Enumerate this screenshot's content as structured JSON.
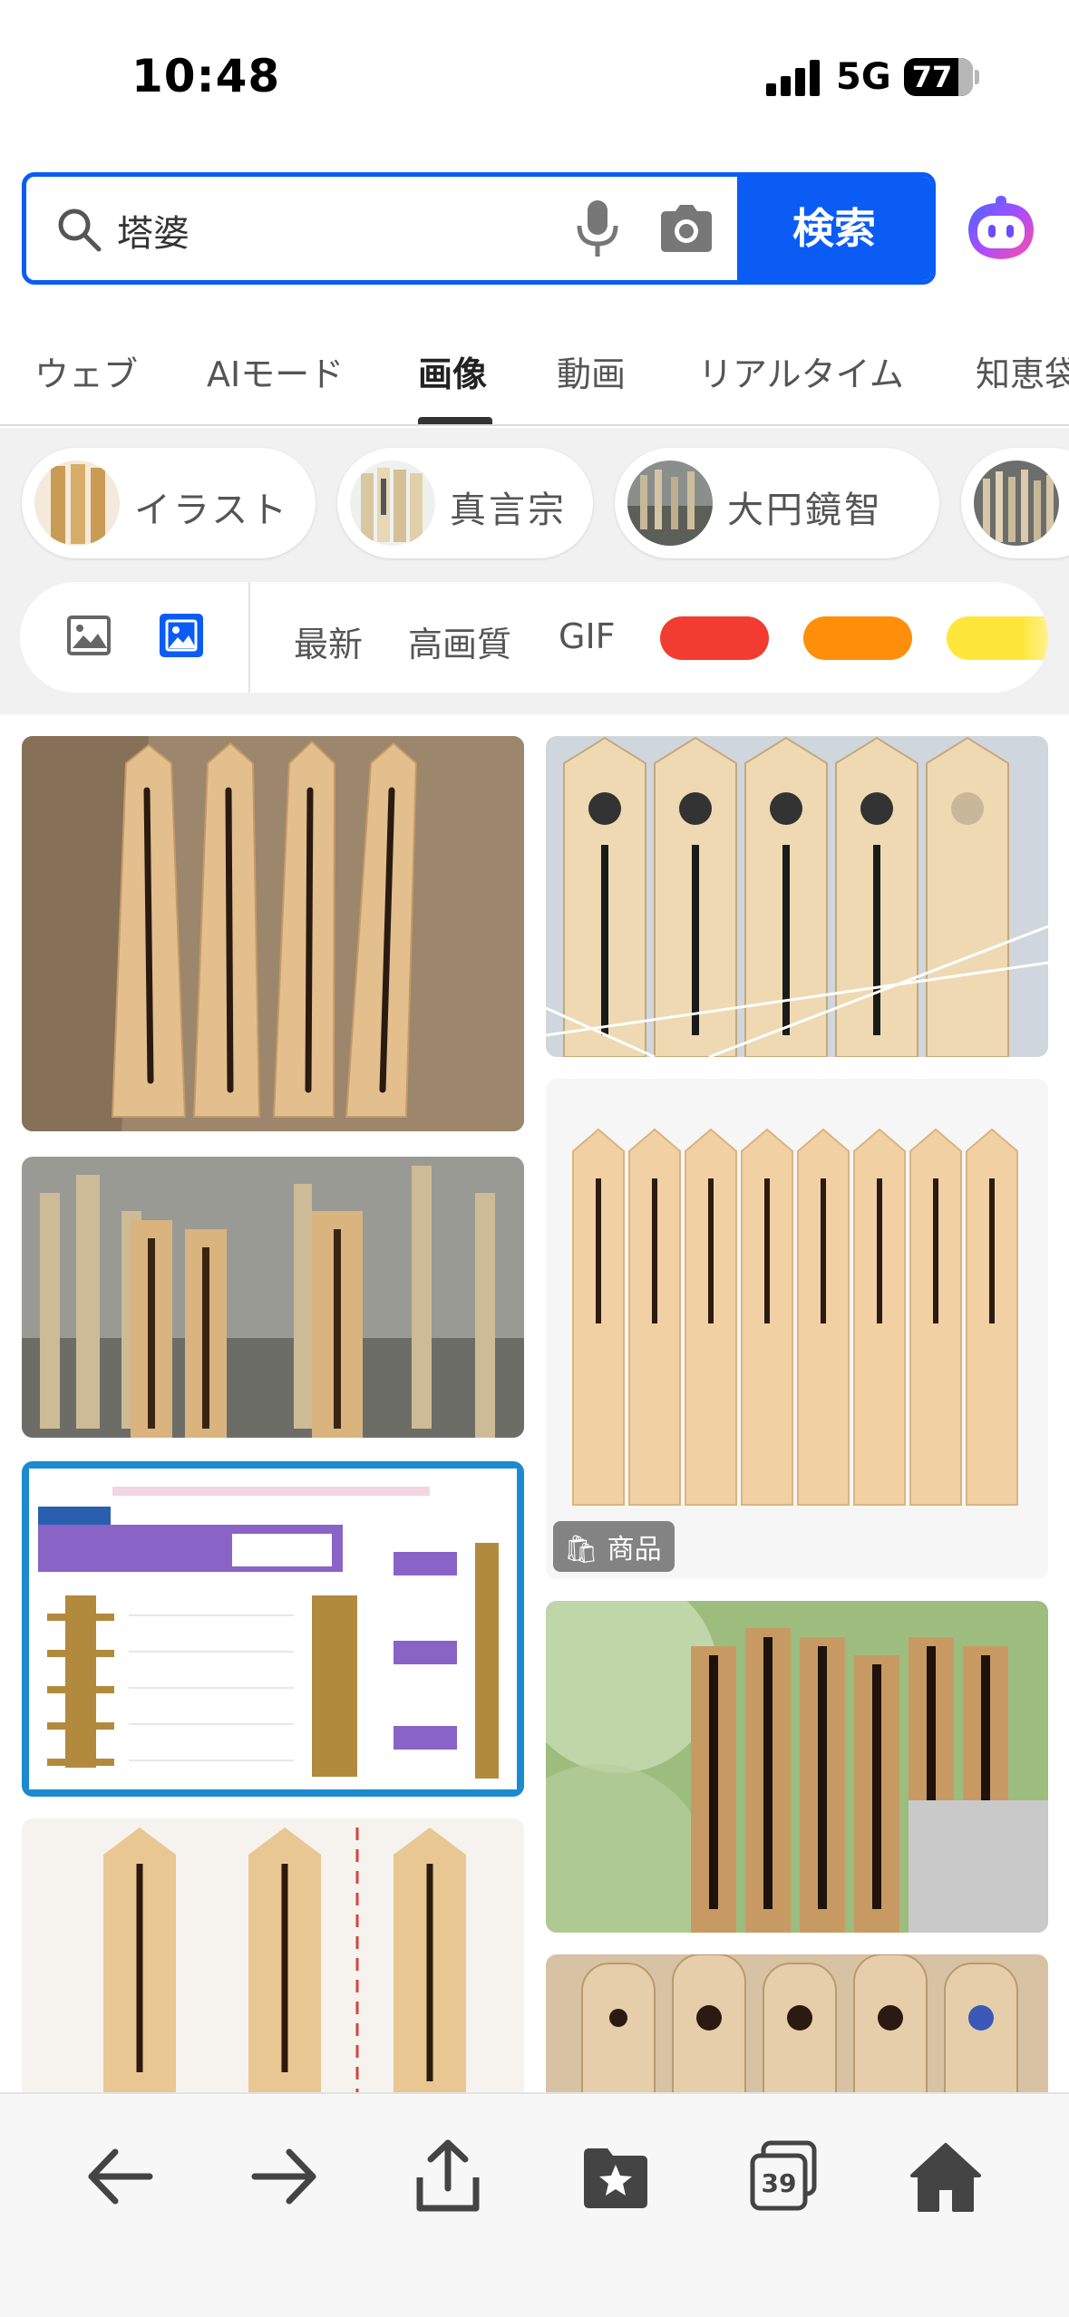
{
  "status_bar": {
    "time": "10:48",
    "network": "5G",
    "battery": "77"
  },
  "search": {
    "query": "塔婆",
    "button_label": "検索",
    "icons": [
      "search-icon",
      "microphone-icon",
      "camera-icon",
      "assistant-icon"
    ]
  },
  "tabs": [
    {
      "label": "ウェブ",
      "active": false
    },
    {
      "label": "AIモード",
      "active": false
    },
    {
      "label": "画像",
      "active": true
    },
    {
      "label": "動画",
      "active": false
    },
    {
      "label": "リアルタイム",
      "active": false
    },
    {
      "label": "知恵袋",
      "active": false
    }
  ],
  "suggestions": [
    {
      "label": "イラスト"
    },
    {
      "label": "真言宗"
    },
    {
      "label": "大円鏡智"
    }
  ],
  "filters": {
    "labels": [
      "最新",
      "高画質",
      "GIF"
    ],
    "colors": [
      "#f23c32",
      "#ff8e0a",
      "#ffe63a"
    ]
  },
  "results": {
    "badge": "商品"
  },
  "toolbar": {
    "tab_count": "39",
    "icons": [
      "back-arrow-icon",
      "forward-arrow-icon",
      "share-icon",
      "bookmarks-icon",
      "tabs-icon",
      "home-icon"
    ]
  },
  "colors": {
    "accent": "#0a5cf5"
  }
}
